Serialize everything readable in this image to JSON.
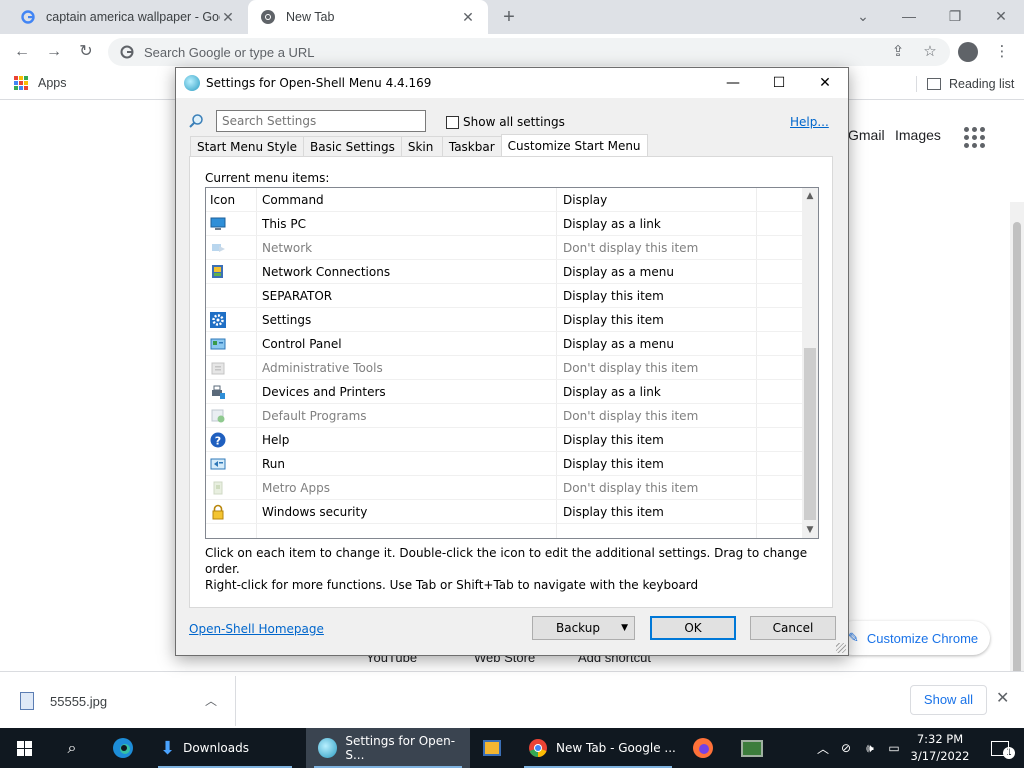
{
  "chrome": {
    "tabs": [
      {
        "title": "captain america wallpaper - Goo",
        "active": false
      },
      {
        "title": "New Tab",
        "active": true
      }
    ],
    "new_tab_symbol": "+",
    "omnibox_placeholder": "Search Google or type a URL",
    "bookmarks": {
      "apps_label": "Apps",
      "reading_list_label": "Reading list"
    }
  },
  "new_tab_page": {
    "gmail": "Gmail",
    "images": "Images",
    "customize_label": "Customize Chrome",
    "shortcuts": [
      "YouTube",
      "Web Store",
      "Add shortcut"
    ]
  },
  "downloads": {
    "file_name": "55555.jpg",
    "show_all_label": "Show all"
  },
  "dialog": {
    "title": "Settings for Open-Shell Menu 4.4.169",
    "search_placeholder": "Search Settings",
    "show_all_settings_label": "Show all settings",
    "help_label": "Help...",
    "tabs": [
      "Start Menu Style",
      "Basic Settings",
      "Skin",
      "Taskbar",
      "Customize Start Menu"
    ],
    "selected_tab": "Customize Start Menu",
    "current_items_label": "Current menu items:",
    "columns": {
      "icon": "Icon",
      "command": "Command",
      "display": "Display"
    },
    "rows": [
      {
        "icon": "monitor-icon",
        "command": "This PC",
        "display": "Display as a link",
        "dim": false
      },
      {
        "icon": "network-icon",
        "command": "Network",
        "display": "Don't display this item",
        "dim": true
      },
      {
        "icon": "network-connections-icon",
        "command": "Network Connections",
        "display": "Display as a menu",
        "dim": false
      },
      {
        "icon": "",
        "command": "SEPARATOR",
        "display": "Display this item",
        "dim": false
      },
      {
        "icon": "gear-icon",
        "command": "Settings",
        "display": "Display this item",
        "dim": false
      },
      {
        "icon": "control-panel-icon",
        "command": "Control Panel",
        "display": "Display as a menu",
        "dim": false
      },
      {
        "icon": "admin-tools-icon",
        "command": "Administrative Tools",
        "display": "Don't display this item",
        "dim": true
      },
      {
        "icon": "printer-icon",
        "command": "Devices and Printers",
        "display": "Display as a link",
        "dim": false
      },
      {
        "icon": "default-programs-icon",
        "command": "Default Programs",
        "display": "Don't display this item",
        "dim": true
      },
      {
        "icon": "help-icon",
        "command": "Help",
        "display": "Display this item",
        "dim": false
      },
      {
        "icon": "run-icon",
        "command": "Run",
        "display": "Display this item",
        "dim": false
      },
      {
        "icon": "metro-apps-icon",
        "command": "Metro Apps",
        "display": "Don't display this item",
        "dim": true
      },
      {
        "icon": "lock-icon",
        "command": "Windows security",
        "display": "Display this item",
        "dim": false
      }
    ],
    "hint_line1": "Click on each item to change it. Double-click the icon to edit the additional settings. Drag to change order.",
    "hint_line2": "Right-click for more functions. Use Tab or Shift+Tab to navigate with the keyboard",
    "homepage_label": "Open-Shell Homepage",
    "backup_label": "Backup",
    "ok_label": "OK",
    "cancel_label": "Cancel"
  },
  "taskbar": {
    "items": [
      "Downloads",
      "Settings for Open-S...",
      "New Tab - Google ..."
    ],
    "time": "7:32 PM",
    "date": "3/17/2022",
    "notification_count": "1"
  },
  "colors": {
    "chrome_blue": "#1a73e8",
    "link_blue": "#0066cc",
    "dialog_bg": "#f0f0f0",
    "taskbar_bg": "#101820",
    "dim_text": "#808080"
  }
}
